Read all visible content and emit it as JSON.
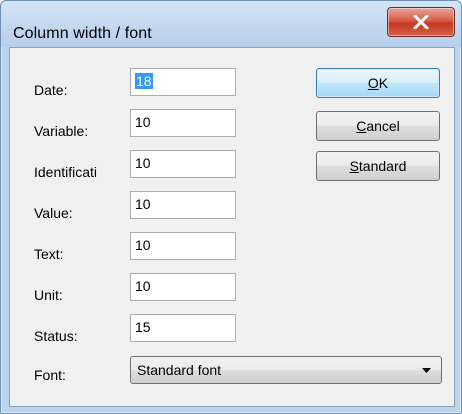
{
  "window": {
    "title": "Column width / font",
    "close_icon": "close-x-icon"
  },
  "fields": [
    {
      "label": "Date:",
      "value": "18",
      "selected": true
    },
    {
      "label": "Variable:",
      "value": "10"
    },
    {
      "label": "Identificati",
      "value": "10"
    },
    {
      "label": "Value:",
      "value": "10"
    },
    {
      "label": "Text:",
      "value": "10"
    },
    {
      "label": "Unit:",
      "value": "10"
    },
    {
      "label": "Status:",
      "value": "15"
    }
  ],
  "font": {
    "label": "Font:",
    "selected": "Standard font",
    "icon": "chevron-down-icon"
  },
  "buttons": {
    "ok": {
      "pre": "",
      "mnemonic": "O",
      "post": "K"
    },
    "cancel": {
      "pre": "",
      "mnemonic": "C",
      "post": "ancel"
    },
    "standard": {
      "pre": "",
      "mnemonic": "S",
      "post": "tandard"
    }
  }
}
